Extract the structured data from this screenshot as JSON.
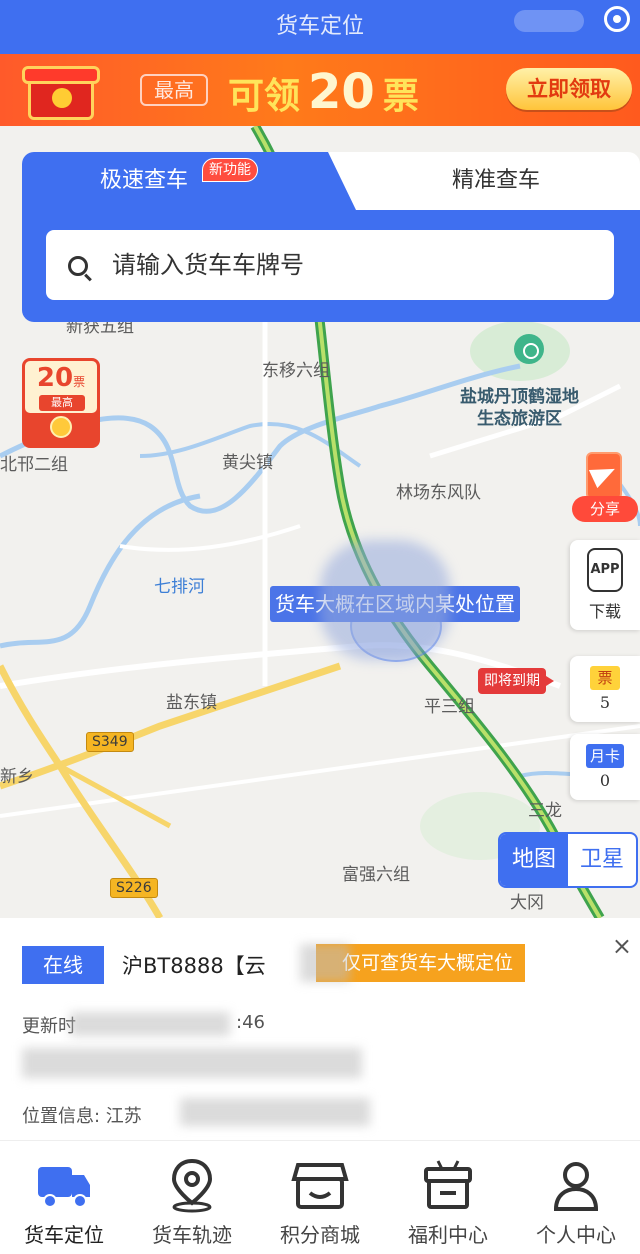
{
  "header": {
    "title": "货车定位"
  },
  "promo": {
    "tag": "最高",
    "prefix": "可领",
    "number": "20",
    "suffix": "票",
    "claim_button": "立即领取"
  },
  "search_panel": {
    "tab_fast": "极速查车",
    "tab_fast_badge": "新功能",
    "tab_precise": "精准查车",
    "placeholder": "请输入货车车牌号"
  },
  "red_packet": {
    "amount": "20",
    "unit": "票",
    "caption": "最高"
  },
  "map": {
    "places": [
      {
        "id": "dongyi",
        "name": "东移六组"
      },
      {
        "id": "wetland",
        "name": "盐城丹顶鹤湿地\n生态旅游区"
      },
      {
        "id": "beishao",
        "name": "北邗二组"
      },
      {
        "id": "huangjian",
        "name": "黄尖镇"
      },
      {
        "id": "linchang",
        "name": "林场东风队"
      },
      {
        "id": "qipai",
        "name": "七排河"
      },
      {
        "id": "yandong",
        "name": "盐东镇"
      },
      {
        "id": "ping3",
        "name": "平三组"
      },
      {
        "id": "xinxiang",
        "name": "新乡"
      },
      {
        "id": "fuqiang",
        "name": "富强六组"
      },
      {
        "id": "sanlong",
        "name": "三龙"
      },
      {
        "id": "dagang",
        "name": "大冈"
      },
      {
        "id": "top_partial",
        "name": "新获五组"
      }
    ],
    "roads": {
      "s349": "S349",
      "s226": "S226"
    },
    "location_tip": "货车大概在区域内某处位置",
    "view_toggle": {
      "map": "地图",
      "satellite": "卫星"
    }
  },
  "side": {
    "share": "分享",
    "app_icon": "APP",
    "download": "下载",
    "expiring": "即将到期",
    "ticket_label": "票",
    "ticket_count": "5",
    "month_card_label": "月卡",
    "month_card_count": "0"
  },
  "info_card": {
    "status": "在线",
    "plate": "沪BT8888【云",
    "hint": "仅可查货车大概定位",
    "update_label": "更新时",
    "update_time_fragment": ":46",
    "location_label": "位置信息: 江苏",
    "close": "×"
  },
  "bottom_nav": [
    {
      "label": "货车定位",
      "icon": "truck-icon"
    },
    {
      "label": "货车轨迹",
      "icon": "track-pin-icon"
    },
    {
      "label": "积分商城",
      "icon": "store-icon"
    },
    {
      "label": "福利中心",
      "icon": "gift-box-icon"
    },
    {
      "label": "个人中心",
      "icon": "person-icon"
    }
  ],
  "colors": {
    "primary": "#3f6ff0",
    "promo": "#ff5a2a",
    "hint": "#f6a21e",
    "expire": "#e43a3a"
  }
}
